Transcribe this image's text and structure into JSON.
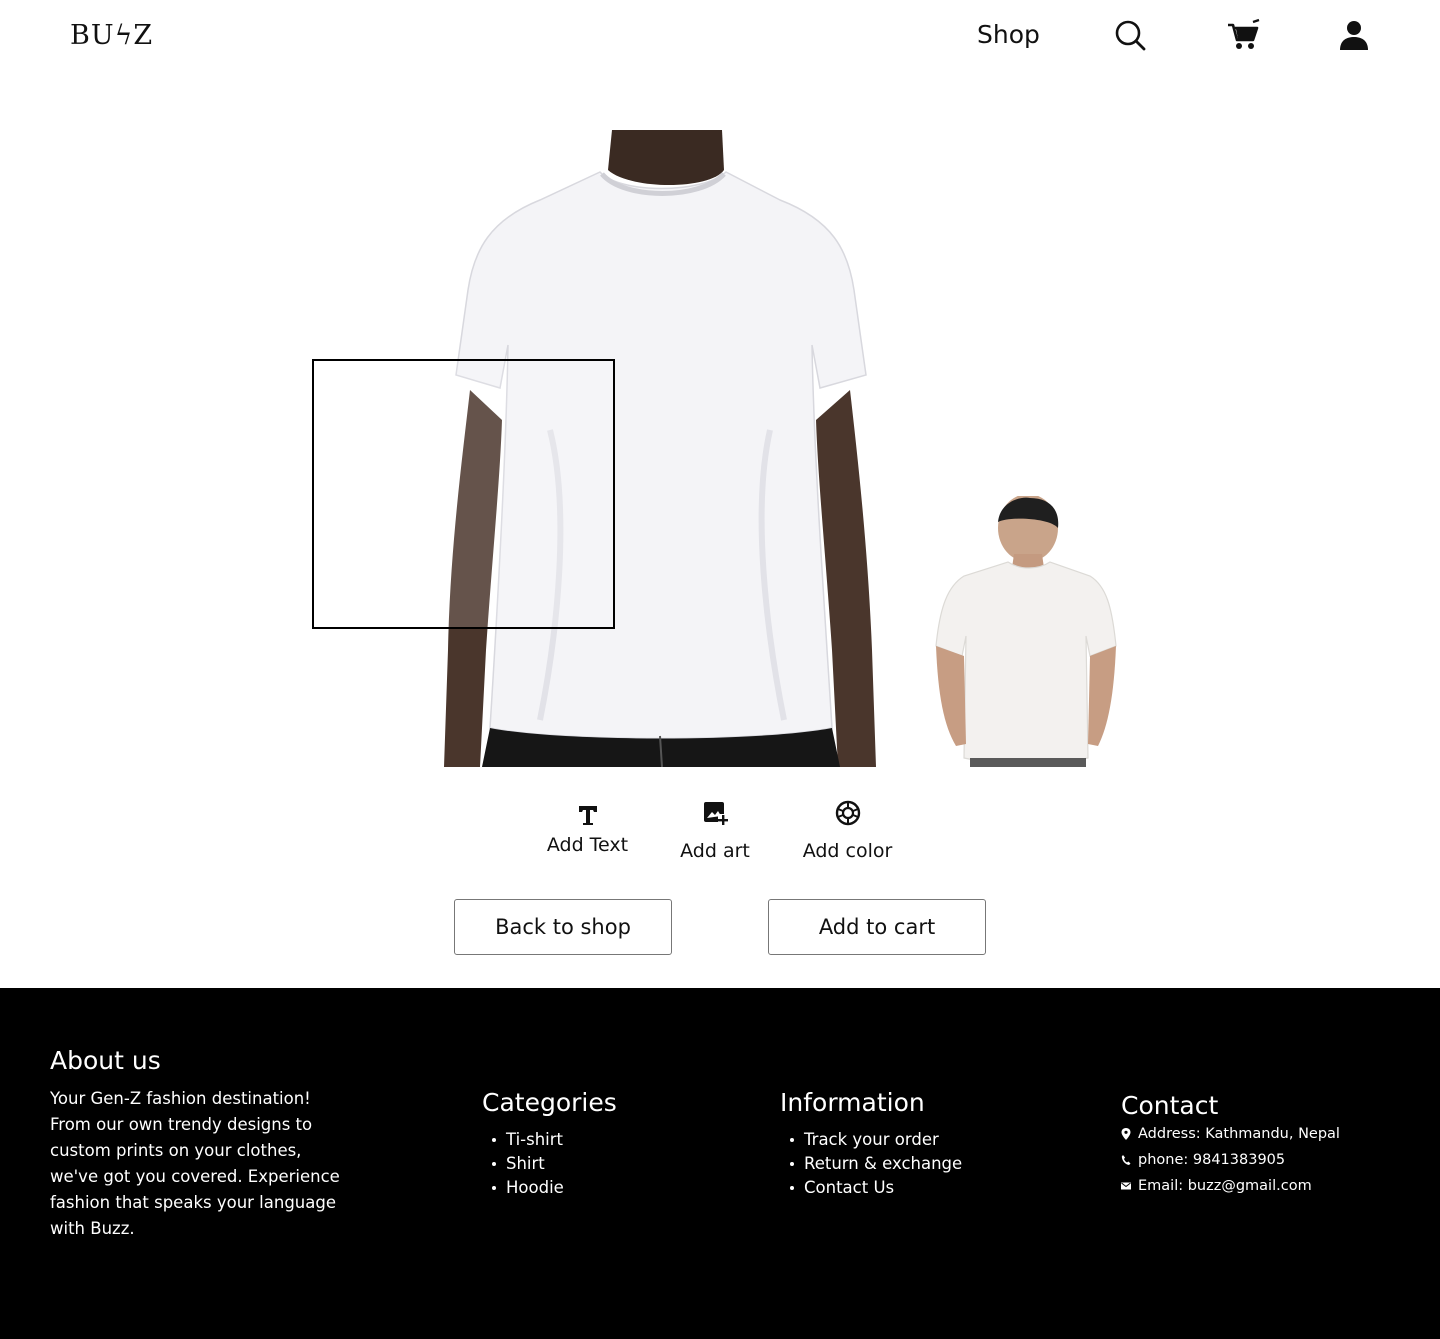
{
  "header": {
    "logo": "BUϟZ",
    "nav_shop": "Shop",
    "icons": [
      "search-icon",
      "cart-icon",
      "user-icon"
    ]
  },
  "tools": {
    "add_text": "Add Text",
    "add_art": "Add art",
    "add_color": "Add color",
    "icons": [
      "text-icon",
      "add-image-icon",
      "palette-icon"
    ]
  },
  "buttons": {
    "back_to_shop": "Back to shop",
    "add_to_cart": "Add to cart"
  },
  "footer": {
    "about": {
      "title": "About us",
      "text": "Your Gen-Z fashion destination! From our own trendy designs to custom prints on your clothes, we've got you covered. Experience fashion that speaks your language with Buzz."
    },
    "categories": {
      "title": "Categories",
      "items": [
        "Ti-shirt",
        "Shirt",
        "Hoodie"
      ]
    },
    "information": {
      "title": "Information",
      "items": [
        "Track your order",
        "Return & exchange",
        "Contact Us"
      ]
    },
    "contact": {
      "title": "Contact",
      "address": "Address: Kathmandu, Nepal",
      "phone": "phone: 9841383905",
      "email": "Email: buzz@gmail.com"
    }
  },
  "colors": {
    "background": "#ffffff",
    "footer_bg": "#000000",
    "text": "#111111",
    "footer_text": "#ffffff"
  }
}
